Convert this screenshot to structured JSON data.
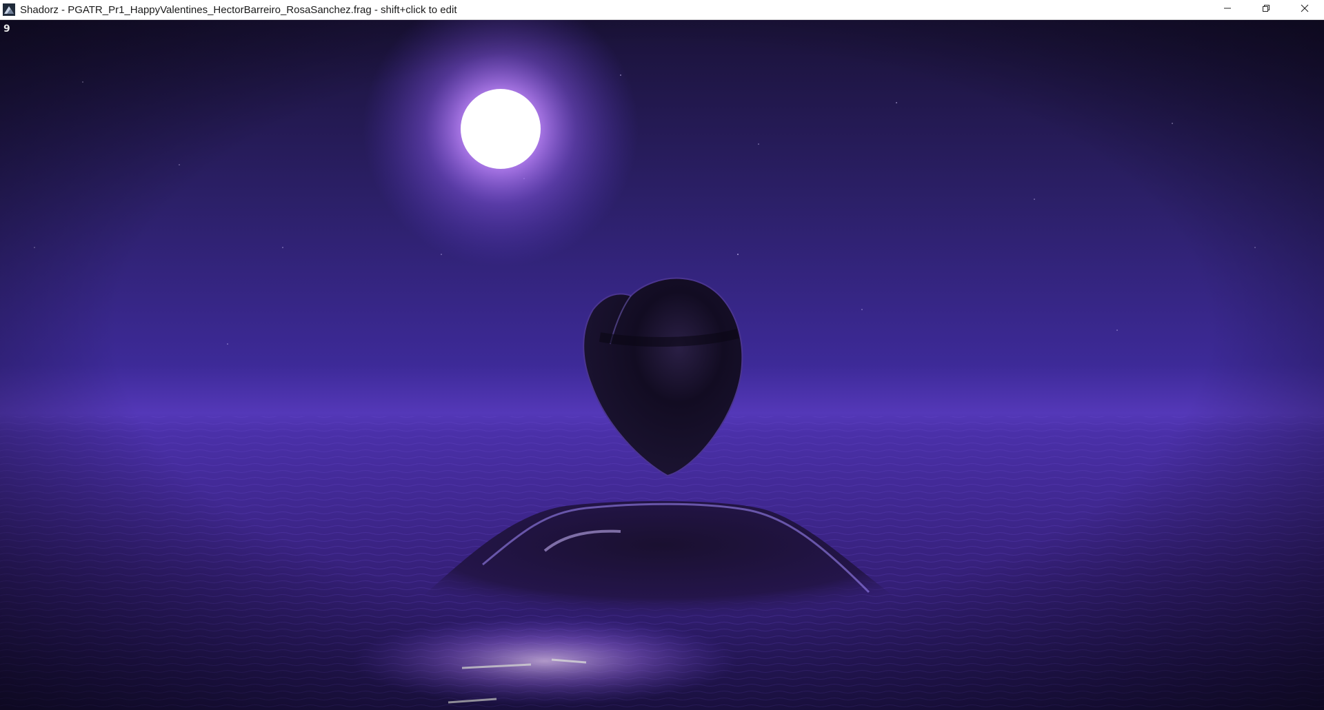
{
  "window": {
    "title": "Shadorz - PGATR_Pr1_HappyValentines_HectorBarreiro_RosaSanchez.frag - shift+click to edit",
    "app_icon": "shadorz-app-icon",
    "controls": {
      "minimize_icon": "minimize-icon",
      "restore_icon": "restore-icon",
      "close_icon": "close-icon"
    }
  },
  "overlay": {
    "frame_counter": "9"
  },
  "scene": {
    "sky_color_top": "#1e1440",
    "sky_color_mid": "#3a2a8c",
    "horizon_color": "#5e3fc7",
    "sea_color": "#3b2380",
    "moon_color": "#ffffff",
    "moon_glow_color": "#b77cff",
    "object_color": "#0f0a1e",
    "objects": [
      "moon",
      "floating-heart-shape",
      "water-bulge",
      "moon-reflection"
    ]
  }
}
